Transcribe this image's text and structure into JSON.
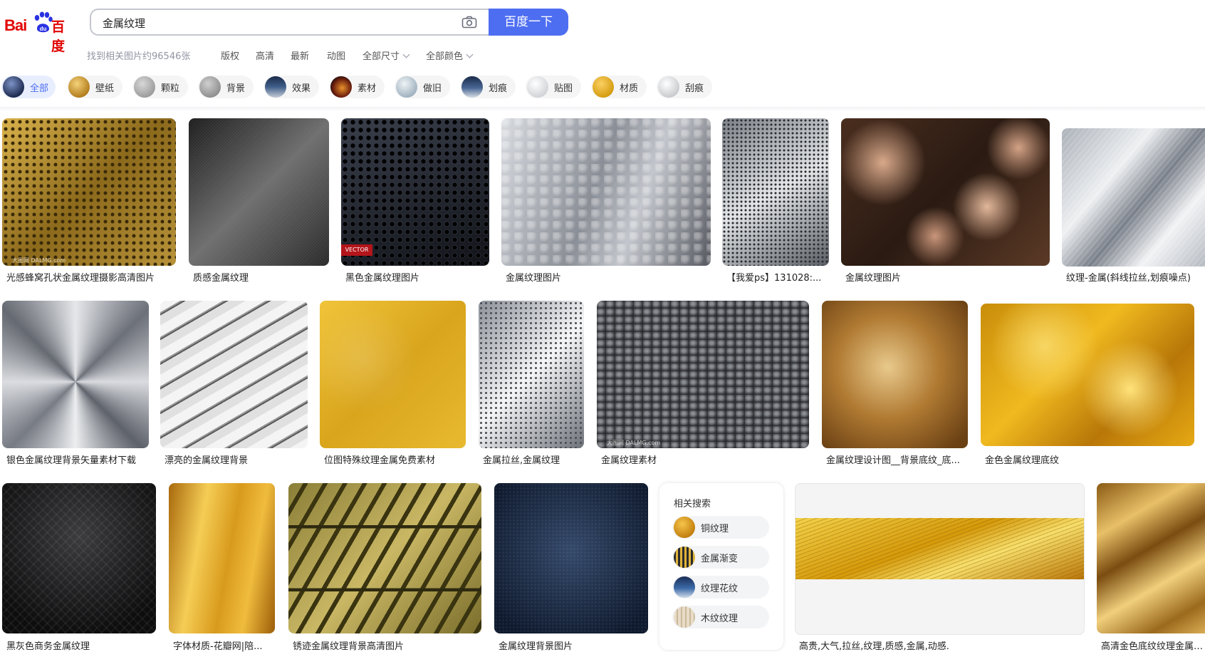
{
  "logo": {
    "latin": "Bai",
    "du": "du",
    "chinese": "百度"
  },
  "search": {
    "query": "金属纹理",
    "button_label": "百度一下"
  },
  "toolbar": {
    "result_count": "找到相关图片约96546张",
    "filters": [
      "版权",
      "高清",
      "最新",
      "动图"
    ],
    "dropdowns": [
      "全部尺寸",
      "全部颜色"
    ]
  },
  "chips": [
    "全部",
    "壁纸",
    "颗粒",
    "背景",
    "效果",
    "素材",
    "做旧",
    "划痕",
    "贴图",
    "材质",
    "刮痕"
  ],
  "results": {
    "row1": [
      "光感蜂窝孔状金属纹理摄影高清图片",
      "质感金属纹理",
      "黑色金属纹理图片",
      "金属纹理图片",
      "【我爱ps】131028:...",
      "金属纹理图片",
      "纹理-金属(斜线拉丝,划痕噪点)"
    ],
    "row2": [
      "银色金属纹理背景矢量素材下载",
      "漂亮的金属纹理背景",
      "位图特殊纹理金属免费素材",
      "金属拉丝,金属纹理",
      "金属纹理素材",
      "金属纹理设计图__背景底纹_底...",
      "金色金属纹理底纹"
    ],
    "row3": [
      "黑灰色商务金属纹理",
      "字体材质-花瓣网|陪...",
      "锈迹金属纹理背景高清图片",
      "金属纹理背景图片",
      "高贵,大气,拉丝,纹理,质感,金属,动感.",
      "高清金色底纹纹理金属质感"
    ]
  },
  "watermarks": {
    "dalmg": "大图网 DALMG.com",
    "vector": "VECTOR"
  },
  "related": {
    "title": "相关搜索",
    "items": [
      "铜纹理",
      "金属渐变",
      "纹理花纹",
      "木纹纹理"
    ]
  },
  "colors": {
    "brand_red": "#e10602",
    "accent_blue": "#4e6ef2",
    "muted_text": "#9195a3"
  }
}
